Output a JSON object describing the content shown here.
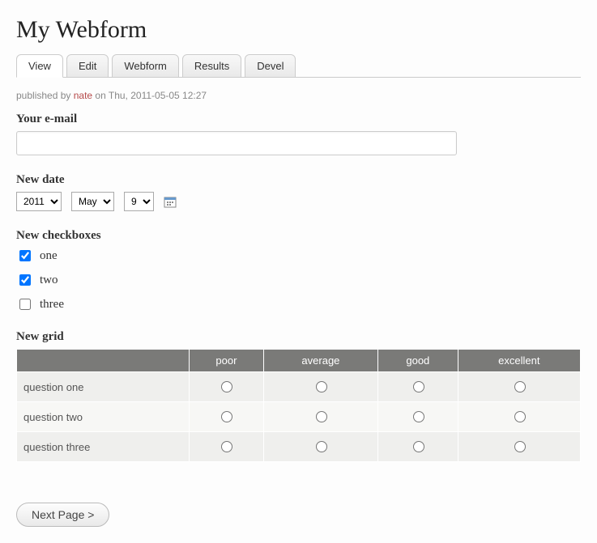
{
  "page": {
    "title": "My Webform"
  },
  "tabs": {
    "items": [
      "View",
      "Edit",
      "Webform",
      "Results",
      "Devel"
    ],
    "activeIndex": 0
  },
  "meta": {
    "prefix": "published by ",
    "author": "nate",
    "suffix": " on Thu, 2011-05-05 12:27"
  },
  "email": {
    "label": "Your e-mail",
    "value": ""
  },
  "date": {
    "label": "New date",
    "year": "2011",
    "month": "May",
    "day": "9"
  },
  "checkboxes": {
    "label": "New checkboxes",
    "items": [
      {
        "label": "one",
        "checked": true
      },
      {
        "label": "two",
        "checked": true
      },
      {
        "label": "three",
        "checked": false
      }
    ]
  },
  "grid": {
    "label": "New grid",
    "columns": [
      "poor",
      "average",
      "good",
      "excellent"
    ],
    "rows": [
      "question one",
      "question two",
      "question three"
    ]
  },
  "actions": {
    "next": "Next Page >"
  }
}
